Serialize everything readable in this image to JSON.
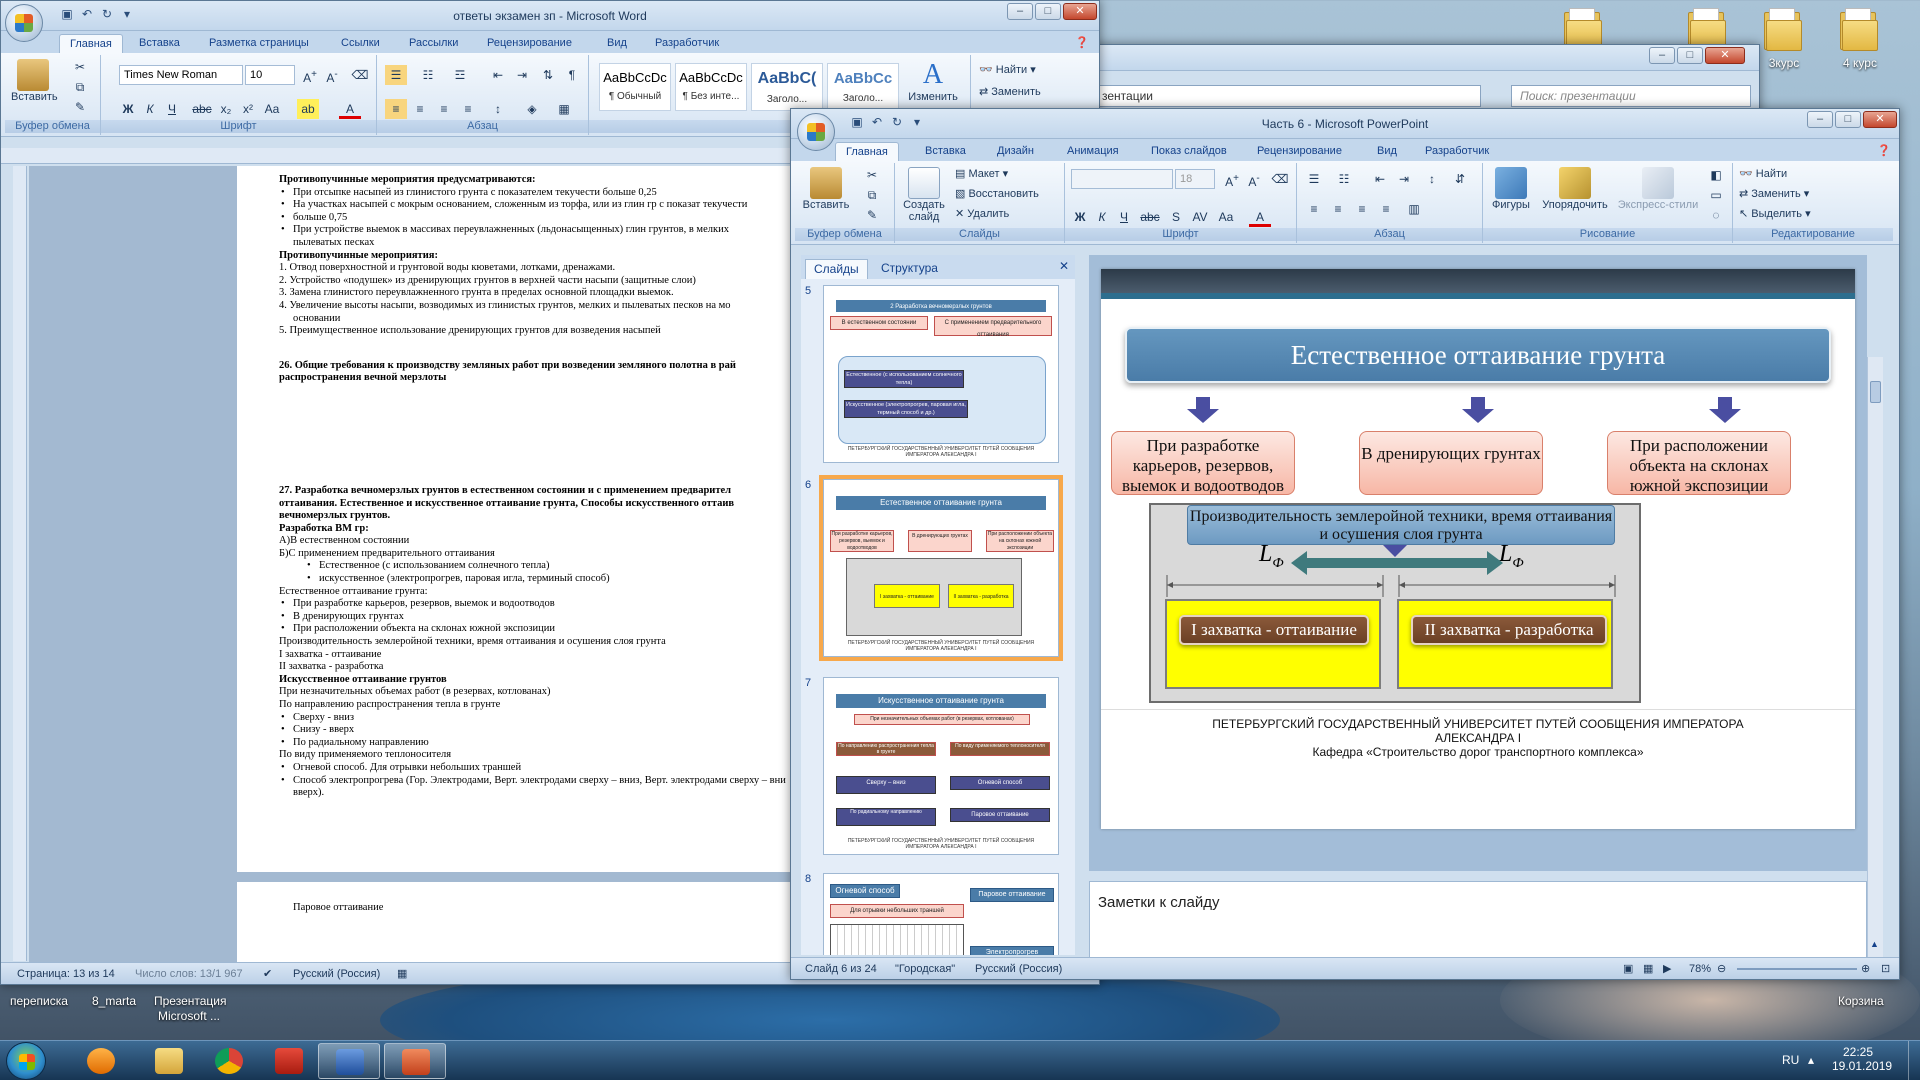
{
  "desktop": {
    "icons": [
      {
        "label": "3курс",
        "icon": "folder-icon"
      },
      {
        "label": "4 курс",
        "icon": "folder-icon"
      }
    ],
    "bottom_labels": [
      "переписка",
      "8_marta",
      "Презентация",
      "Microsoft ...",
      "Корзина"
    ]
  },
  "word": {
    "title": "ответы экзамен зп - Microsoft Word",
    "tabs": [
      "Главная",
      "Вставка",
      "Разметка страницы",
      "Ссылки",
      "Рассылки",
      "Рецензирование",
      "Вид",
      "Разработчик"
    ],
    "clipboard": {
      "paste": "Вставить",
      "group": "Буфер обмена"
    },
    "font": {
      "name": "Times New Roman",
      "size": "10",
      "group": "Шрифт"
    },
    "paragraph_group": "Абзац",
    "styles": [
      {
        "sample": "AaBbCcDc",
        "name": "¶ Обычный"
      },
      {
        "sample": "AaBbCcDc",
        "name": "¶ Без инте..."
      },
      {
        "sample": "AaBbC(",
        "name": "Заголо..."
      },
      {
        "sample": "AaBbCc",
        "name": "Заголо..."
      }
    ],
    "styles_group": "Стили",
    "change_styles": "Изменить",
    "editing": {
      "find": "Найти",
      "replace": "Заменить"
    },
    "document": [
      {
        "cls": "h",
        "text": "Противопучинные мероприятия предусматриваются:"
      },
      {
        "cls": "b1",
        "text": "При отсыпке насыпей из глинистого грунта с показателем текучести больше 0,25"
      },
      {
        "cls": "b1",
        "text": "На участках насыпей с мокрым основанием, сложенным из торфа, или из глин гр с показат текучести"
      },
      {
        "cls": "b1",
        "text": "больше 0,75"
      },
      {
        "cls": "b1",
        "text": "При устройстве выемок в массивах переувлажненных (льдонасыщенных) глин грунтов, в мелких"
      },
      {
        "cls": "n1",
        "text": "пылеватых песках"
      },
      {
        "cls": "h",
        "text": "Противопучинные мероприятия:"
      },
      {
        "cls": "",
        "text": "1.  Отвод поверхностной и грунтовой воды кюветами, лотками, дренажами."
      },
      {
        "cls": "",
        "text": "2.  Устройство «подушек» из дренирующих грунтов в верхней части насыпи (защитные слои)"
      },
      {
        "cls": "",
        "text": "3.  Замена глинистого переувлажненного грунта в пределах основной площадки выемок."
      },
      {
        "cls": "",
        "text": "4.  Увеличение высоты насыпи, возводимых из глинистых грунтов, мелких и пылеватых песков на мо"
      },
      {
        "cls": "n1",
        "text": "основании"
      },
      {
        "cls": "",
        "text": "5.  Преимущественное использование дренирующих грунтов для возведения насыпей"
      },
      {
        "cls": "gap",
        "text": ""
      },
      {
        "cls": "h",
        "text": "26. Общие требования к производству земляных работ при возведении земляного полотна в рай"
      },
      {
        "cls": "h",
        "text": "распространения вечной мерзлоты"
      },
      {
        "cls": "gap-big",
        "text": ""
      },
      {
        "cls": "h",
        "text": "27. Разработка вечномерзлых грунтов в естественном состоянии и с применением предварител"
      },
      {
        "cls": "h",
        "text": "оттаивания. Естественное и искусственное оттаивание грунта, Способы искусственного оттаив"
      },
      {
        "cls": "h",
        "text": "вечномерзлых грунтов."
      },
      {
        "cls": "h",
        "text": "Разработка ВМ гр:"
      },
      {
        "cls": "",
        "text": "А)В естественном состоянии"
      },
      {
        "cls": "",
        "text": "Б)С применением предварительного оттаивания"
      },
      {
        "cls": "b2",
        "text": "Естественное (с использованием солнечного тепла)"
      },
      {
        "cls": "b2",
        "text": "искусственное (электропрогрев, паровая игла, терминый способ)"
      },
      {
        "cls": "",
        "text": "Естественное оттаивание грунта:"
      },
      {
        "cls": "b1",
        "text": "При разработке карьеров, резервов, выемок и водоотводов"
      },
      {
        "cls": "b1",
        "text": "В дренирующих грунтах"
      },
      {
        "cls": "b1",
        "text": "При расположении объекта на склонах южной экспозиции"
      },
      {
        "cls": "",
        "text": "Производительность землеройной техники, время оттаивания и осушения слоя грунта"
      },
      {
        "cls": "",
        "text": "I захватка - оттаивание"
      },
      {
        "cls": "",
        "text": "II  захватка - разработка"
      },
      {
        "cls": "h",
        "text": " Искусственное оттаивание грунтов"
      },
      {
        "cls": "",
        "text": "При незначительных объемах работ (в резервах, котлованах)"
      },
      {
        "cls": "",
        "text": "По направлению распространения тепла в грунте"
      },
      {
        "cls": "b1",
        "text": "Сверху - вниз"
      },
      {
        "cls": "b1",
        "text": "Снизу  - вверх"
      },
      {
        "cls": "b1",
        "text": "По радиальному направлению"
      },
      {
        "cls": "",
        "text": "По виду применяемого теплоносителя"
      },
      {
        "cls": "b1",
        "text": "Огневой способ.  Для отрывки небольших траншей"
      },
      {
        "cls": "b1",
        "text": "Способ электропрогрева (Гор. Электродами, Верт. электродами сверху – вниз, Верт. электродами сверху – вни"
      },
      {
        "cls": "n1",
        "text": "вверх)."
      }
    ],
    "page2_bullet": "Паровое оттаивание",
    "status": {
      "page": "Страница: 13 из 14",
      "words": "Число слов: 13/1 967",
      "lang": "Русский (Россия)"
    }
  },
  "explorer": {
    "address": "зентации",
    "search_placeholder": "Поиск: презентации"
  },
  "ppt": {
    "title": "Часть 6 - Microsoft PowerPoint",
    "tabs": [
      "Главная",
      "Вставка",
      "Дизайн",
      "Анимация",
      "Показ слайдов",
      "Рецензирование",
      "Вид",
      "Разработчик"
    ],
    "ribbon": {
      "paste": "Вставить",
      "clipboard_group": "Буфер обмена",
      "create_slide": "Создать слайд",
      "layout": "Макет",
      "restore": "Восстановить",
      "delete": "Удалить",
      "slides_group": "Слайды",
      "font_size": "18",
      "font_group": "Шрифт",
      "paragraph_group": "Абзац",
      "figures": "Фигуры",
      "arrange": "Упорядочить",
      "express": "Экспресс-стили",
      "drawing_group": "Рисование",
      "find": "Найти",
      "replace": "Заменить",
      "select": "Выделить",
      "editing_group": "Редактирование"
    },
    "pane_tabs": [
      "Слайды",
      "Структура"
    ],
    "thumbnails": [
      {
        "num": "5",
        "title": "2 Разработка вечномерзлых грунтов",
        "boxes": [
          "В естественном состоянии",
          "С применением предварительного оттаивания"
        ],
        "items": [
          "Естественное (с использованием солнечного тепла)",
          "Искусственное (электропрогрев, паровая игла, термный способ и др.)"
        ]
      },
      {
        "num": "6",
        "title": "Естественное оттаивание грунта",
        "boxes": [
          "При разработке карьеров, резервов, выемок и водоотводов",
          "В дренирующих грунтах",
          "При расположении объекта на склонах южной экспозиции"
        ],
        "items": [
          "I захватка - оттаивание",
          "II захватка - разработка"
        ]
      },
      {
        "num": "7",
        "title": "Искусственное оттаивание грунта",
        "boxes": [
          "При незначительных объемах работ (в резервах, котлованах)",
          "По направлению распространения тепла в грунте",
          "По виду применяемого теплоносителя"
        ],
        "items": [
          "Сверху – вниз",
          "Огневой способ",
          "По радиальному направлению",
          "Паровое оттаивание"
        ]
      },
      {
        "num": "8",
        "title": "",
        "boxes": [
          "Огневой способ",
          "Паровое оттаивание",
          "Для отрывки небольших траншей",
          "Электропрогрев"
        ],
        "items": []
      }
    ],
    "thumb_footer": "ПЕТЕРБУРГСКИЙ ГОСУДАРСТВЕННЫЙ УНИВЕРСИТЕТ ПУТЕЙ СООБЩЕНИЯ ИМПЕРАТОРА АЛЕКСАНДРА I",
    "slide": {
      "title": "Естественное оттаивание грунта",
      "boxes": [
        "При разработке карьеров, резервов, выемок и водоотводов",
        "В дренирующих грунтах",
        "При расположении объекта на склонах южной экспозиции"
      ],
      "productivity": "Производительность землеройной техники, время оттаивания и осушения слоя грунта",
      "l_letter": "L",
      "l_sub": "Ф",
      "stage1": "I захватка - оттаивание",
      "stage2": "II  захватка - разработка",
      "footer1": "ПЕТЕРБУРГСКИЙ ГОСУДАРСТВЕННЫЙ УНИВЕРСИТЕТ ПУТЕЙ СООБЩЕНИЯ ИМПЕРАТОРА",
      "footer2": "АЛЕКСАНДРА I",
      "footer3": "Кафедра «Строительство дорог транспортного комплекса»"
    },
    "notes_placeholder": "Заметки к слайду",
    "status": {
      "slide": "Слайд 6 из 24",
      "theme": "\"Городская\"",
      "lang": "Русский (Россия)",
      "zoom": "78%"
    }
  },
  "taskbar": {
    "lang": "RU",
    "time": "22:25",
    "date": "19.01.2019"
  }
}
